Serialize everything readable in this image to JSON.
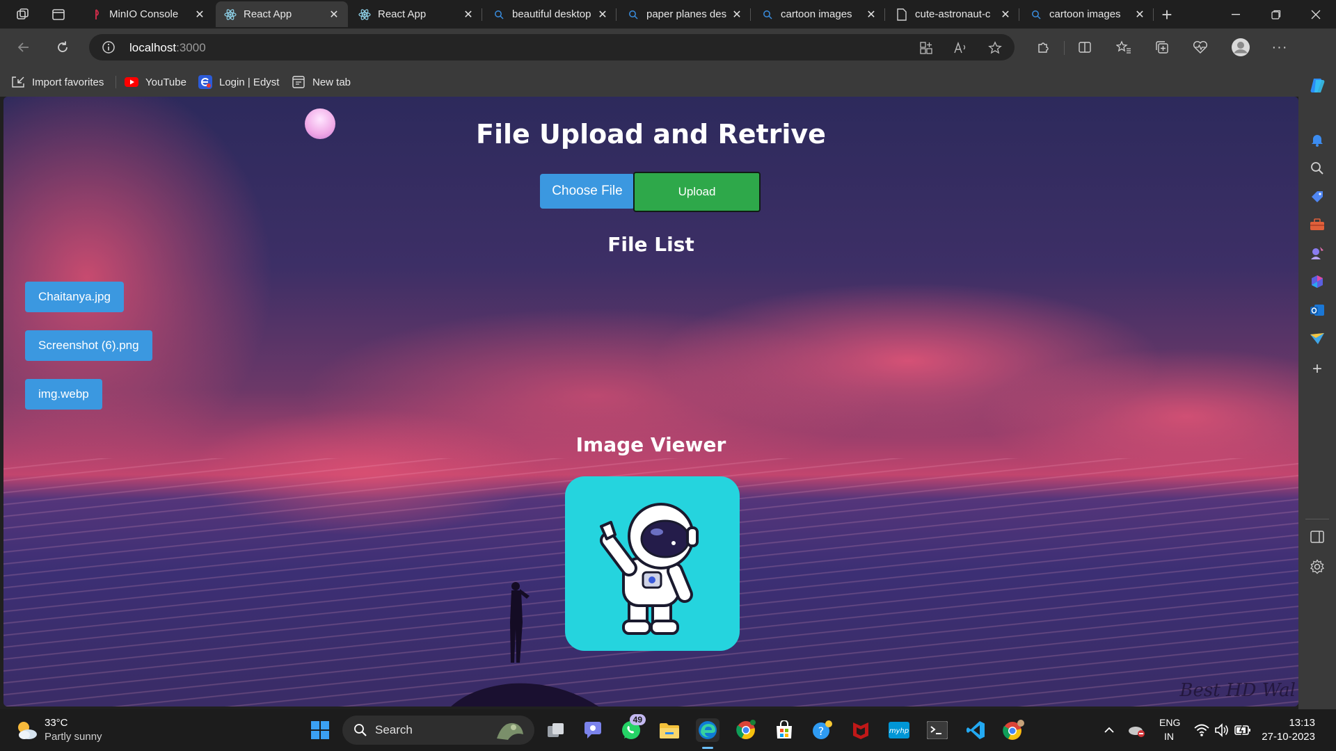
{
  "browser": {
    "tabs": [
      {
        "title": "MinIO Console",
        "active": false
      },
      {
        "title": "React App",
        "active": true
      },
      {
        "title": "React App",
        "active": false
      },
      {
        "title": "beautiful desktop",
        "active": false
      },
      {
        "title": "paper planes des",
        "active": false
      },
      {
        "title": "cartoon images",
        "active": false
      },
      {
        "title": "cute-astronaut-c",
        "active": false
      },
      {
        "title": "cartoon images",
        "active": false
      }
    ],
    "close_symbol": "✕",
    "new_tab_symbol": "+",
    "address": {
      "host": "localhost",
      "port": ":3000"
    },
    "favorites": [
      "Import favorites",
      "YouTube",
      "Login | Edyst",
      "New tab"
    ]
  },
  "page": {
    "title": "File Upload and Retrive",
    "choose_file_label": "Choose File",
    "upload_label": "Upload",
    "file_list_title": "File List",
    "files": [
      "Chaitanya.jpg",
      "Screenshot (6).png",
      "img.webp"
    ],
    "image_viewer_title": "Image Viewer",
    "watermark": "Best HD Wal"
  },
  "taskbar": {
    "weather_temp": "33°C",
    "weather_desc": "Partly sunny",
    "search_label": "Search",
    "whatsapp_badge": "49",
    "lang_top": "ENG",
    "lang_bottom": "IN",
    "time": "13:13",
    "date": "27-10-2023"
  },
  "colors": {
    "primary_button": "#3b98e0",
    "upload_button": "#2ea84a",
    "viewer_bg": "#25d4de"
  }
}
